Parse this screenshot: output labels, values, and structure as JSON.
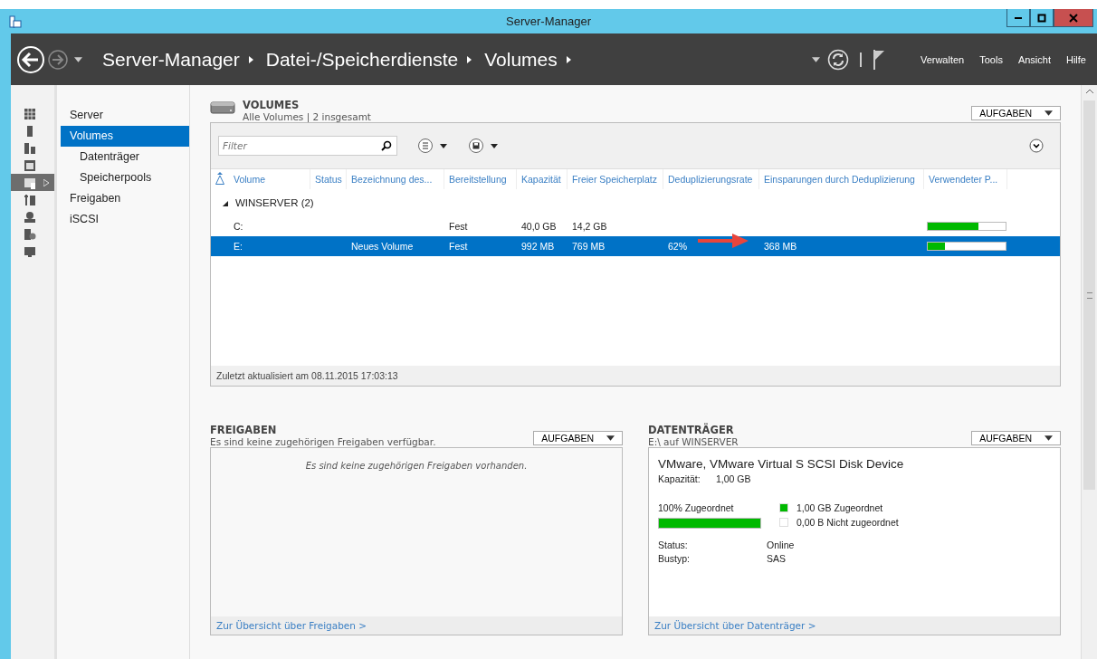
{
  "window": {
    "title": "Server-Manager"
  },
  "breadcrumb": [
    "Server-Manager",
    "Datei-/Speicherdienste",
    "Volumes"
  ],
  "menu": [
    "Verwalten",
    "Tools",
    "Ansicht",
    "Hilfe"
  ],
  "rail": [
    {
      "selected": false
    },
    {
      "selected": false
    },
    {
      "selected": false
    },
    {
      "selected": false
    },
    {
      "selected": true
    },
    {
      "selected": false
    },
    {
      "selected": false
    },
    {
      "selected": false
    },
    {
      "selected": false
    }
  ],
  "nav": [
    {
      "label": "Server",
      "selected": false
    },
    {
      "label": "Volumes",
      "selected": true,
      "children": [
        {
          "label": "Datenträger",
          "selected": false
        },
        {
          "label": "Speicherpools",
          "selected": false
        }
      ]
    },
    {
      "label": "Freigaben",
      "selected": false
    },
    {
      "label": "iSCSI",
      "selected": false
    }
  ],
  "volumes": {
    "title": "VOLUMES",
    "subtitle": "Alle Volumes | 2 insgesamt",
    "tasks": "AUFGABEN",
    "filter_placeholder": "Filter",
    "columns": [
      {
        "label": "Volume"
      },
      {
        "label": "Status"
      },
      {
        "label": "Bezeichnung des..."
      },
      {
        "label": "Bereitstellung"
      },
      {
        "label": "Kapazität"
      },
      {
        "label": "Freier Speicherplatz"
      },
      {
        "label": "Deduplizierungsrate"
      },
      {
        "label": "Einsparungen durch Deduplizierung"
      },
      {
        "label": "Verwendeter P..."
      }
    ],
    "groups": [
      {
        "label": "WINSERVER (2)",
        "expanded": true,
        "rows": [
          {
            "selected": false,
            "level": 0.65,
            "cells": [
              {
                "text": "C:"
              },
              {},
              {},
              {
                "text": "Fest"
              },
              {
                "text": "40,0 GB"
              },
              {
                "text": "14,2 GB"
              },
              {},
              {}
            ]
          },
          {
            "selected": true,
            "level": 0.22,
            "arrow": true,
            "cells": [
              {
                "text": "E:"
              },
              {},
              {
                "text": "Neues Volume"
              },
              {
                "text": "Fest"
              },
              {
                "text": "992 MB"
              },
              {
                "text": "769 MB"
              },
              {
                "text": "62%"
              },
              {
                "text": "368 MB"
              }
            ]
          }
        ]
      }
    ],
    "footer": "Zuletzt aktualisiert am 08.11.2015 17:03:13"
  },
  "shares": {
    "title": "FREIGABEN",
    "subtitle": "Es sind keine zugehörigen Freigaben verfügbar.",
    "tasks": "AUFGABEN",
    "empty": "Es sind keine zugehörigen Freigaben vorhanden.",
    "link": "Zur Übersicht über Freigaben >"
  },
  "disks": {
    "title": "DATENTRÄGER",
    "subtitle": "E:\\ auf WINSERVER",
    "tasks": "AUFGABEN",
    "device": "VMware, VMware Virtual S SCSI Disk Device",
    "capacity_label": "Kapazität:",
    "capacity": "1,00 GB",
    "allocated_label": "100% Zugeordnet",
    "level": 1.0,
    "legend": [
      {
        "label": "1,00 GB Zugeordnet",
        "color": "#00b900"
      },
      {
        "label": "0,00 B Nicht zugeordnet",
        "color": "#ffffff"
      }
    ],
    "props": [
      {
        "label": "Status:",
        "value": "Online"
      },
      {
        "label": "Bustyp:",
        "value": "SAS"
      }
    ],
    "link": "Zur Übersicht über Datenträger >"
  }
}
